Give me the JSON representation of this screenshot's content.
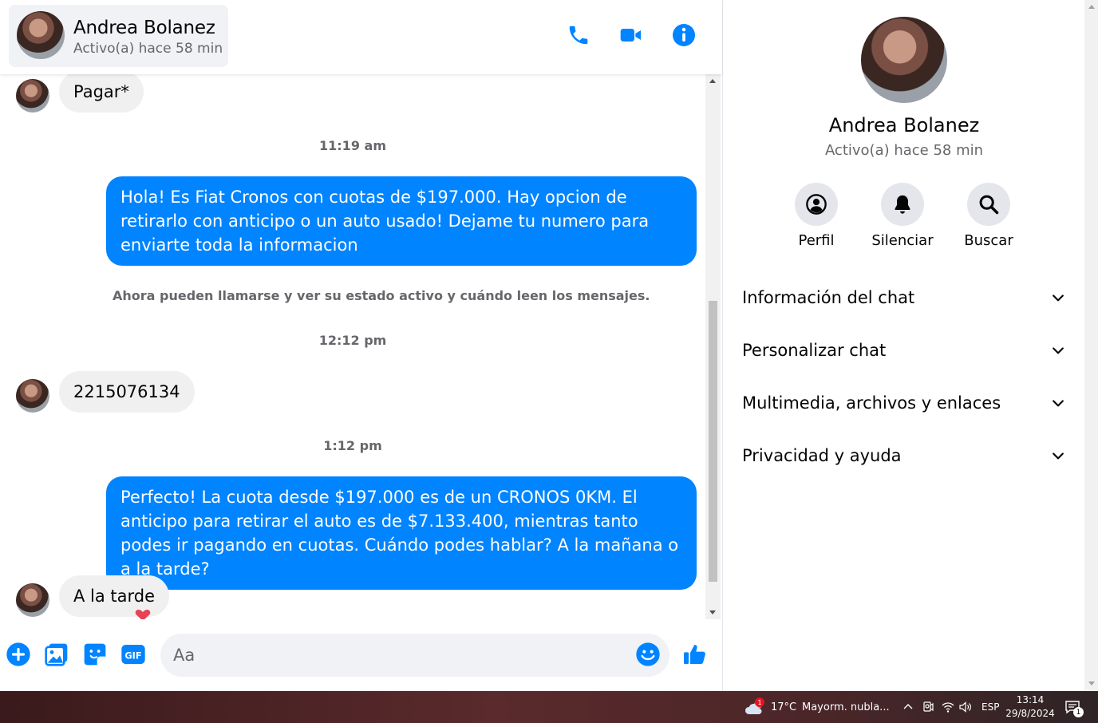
{
  "contact": {
    "name": "Andrea Bolanez",
    "status": "Activo(a) hace 58 min"
  },
  "messages": [
    {
      "type": "in",
      "text": "Pagar*"
    },
    {
      "type": "time",
      "text": "11:19 am"
    },
    {
      "type": "out",
      "text": "Hola! Es Fiat Cronos con cuotas de $197.000. Hay opcion de retirarlo con anticipo o un auto usado! Dejame tu numero para enviarte toda la informacion"
    },
    {
      "type": "system",
      "text": "Ahora pueden llamarse y ver su estado activo y cuándo leen los mensajes."
    },
    {
      "type": "time",
      "text": "12:12 pm"
    },
    {
      "type": "in",
      "text": "2215076134"
    },
    {
      "type": "time",
      "text": "1:12 pm"
    },
    {
      "type": "out",
      "text": "Perfecto! La cuota desde $197.000 es de un CRONOS 0KM. El anticipo para retirar el auto es de $7.133.400, mientras tanto podes ir pagando en cuotas. Cuándo podes hablar? A la mañana o a la tarde?"
    },
    {
      "type": "in",
      "text": "A la tarde"
    }
  ],
  "composer": {
    "placeholder": "Aa",
    "buttons": [
      "plus-icon",
      "image-icon",
      "sticker-icon",
      "gif-icon",
      "emoji-icon",
      "like-icon"
    ]
  },
  "header_icons": [
    "phone-icon",
    "video-icon",
    "info-icon"
  ],
  "panel": {
    "actions": [
      {
        "label": "Perfil",
        "icon": "profile-icon"
      },
      {
        "label": "Silenciar",
        "icon": "bell-icon"
      },
      {
        "label": "Buscar",
        "icon": "search-icon"
      }
    ],
    "sections": [
      "Información del chat",
      "Personalizar chat",
      "Multimedia, archivos y enlaces",
      "Privacidad y ayuda"
    ]
  },
  "taskbar": {
    "weather": "17°C",
    "weather_desc": "Mayorm. nubla...",
    "weather_badge": "1",
    "lang": "ESP",
    "time": "13:14",
    "date": "29/8/2024",
    "notif_count": "1"
  },
  "colors": {
    "accent": "#0084ff",
    "bubble_in": "#f0f0f0",
    "muted_text": "#65676b"
  }
}
